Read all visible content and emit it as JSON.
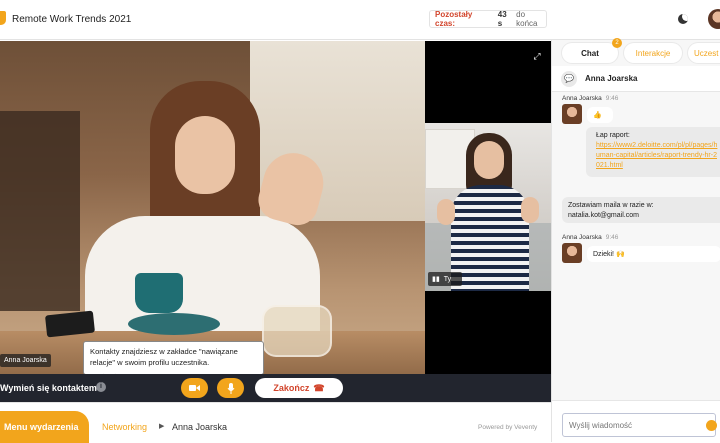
{
  "header": {
    "title": "Remote Work Trends 2021",
    "time_label": "Pozostały czas:",
    "time_value": "43 s",
    "time_suffix": "do końca"
  },
  "video": {
    "main_name": "Anna Joarska",
    "side_audio_label": "Ty"
  },
  "tooltip": {
    "text": "Kontakty znajdziesz w zakładce \"nawiązane relacje\" w swoim profilu uczestnika."
  },
  "controls": {
    "exchange_label": "Wymień się kontaktem",
    "info": "i",
    "end_label": "Zakończ"
  },
  "bottom_nav": {
    "menu_label": "Menu wydarzenia",
    "crumb_networking": "Networking",
    "crumb_name": "Anna Joarska",
    "powered": "Powered by Veventy"
  },
  "chat": {
    "tabs": [
      {
        "label": "Chat",
        "badge": "2"
      },
      {
        "label": "Interakcje"
      },
      {
        "label": "Uczest"
      }
    ],
    "header_name": "Anna Joarska",
    "messages": [
      {
        "author": "Anna Joarska",
        "time": "9:46",
        "text": "👍"
      },
      {
        "text_prefix": "Łap raport:",
        "link": "https://www2.deloitte.com/pl/pl/pages/human-capital/articles/raport-trendy-hr-2021.html"
      },
      {
        "text": "Zostawiam maila w razie w: natalia.kot@gmail.com"
      },
      {
        "author": "Anna Joarska",
        "time": "9:46",
        "text": "Dzieki! 🙌"
      }
    ],
    "input_placeholder": "Wyślij wiadomość"
  },
  "colors": {
    "accent": "#f2a51c",
    "danger": "#d2452c",
    "control_bar": "#22252e"
  }
}
